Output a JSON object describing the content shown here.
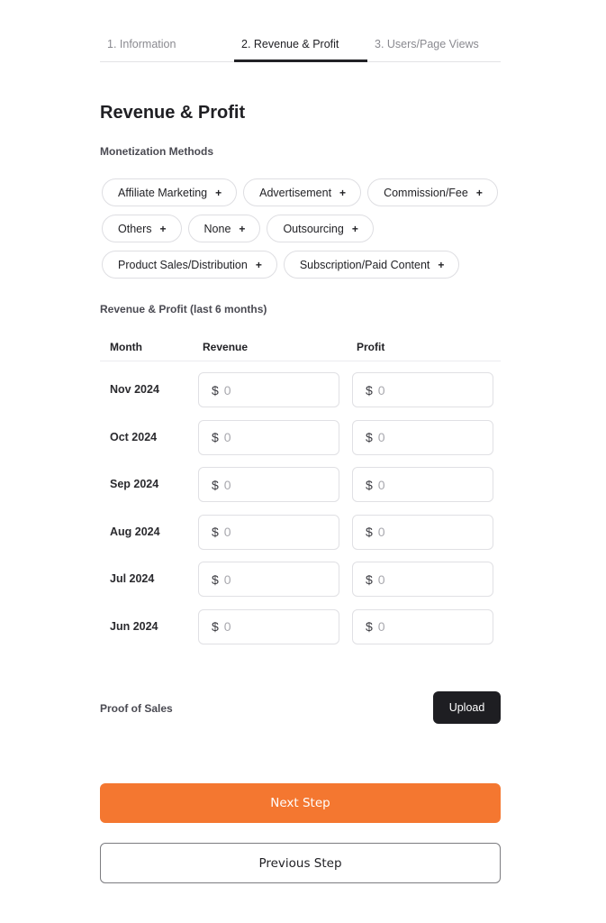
{
  "tabs": [
    {
      "label": "1. Information",
      "active": false
    },
    {
      "label": "2. Revenue & Profit",
      "active": true
    },
    {
      "label": "3. Users/Page Views",
      "active": false
    }
  ],
  "page_title": "Revenue & Profit",
  "monetization": {
    "label": "Monetization Methods",
    "add_icon": "plus-icon",
    "rows": [
      [
        "Affiliate Marketing",
        "Advertisement",
        "Commission/Fee"
      ],
      [
        "Others",
        "None",
        "Outsourcing"
      ],
      [
        "Product Sales/Distribution",
        "Subscription/Paid Content"
      ]
    ]
  },
  "revenue_table": {
    "label": "Revenue & Profit (last 6 months)",
    "headers": {
      "month": "Month",
      "revenue": "Revenue",
      "profit": "Profit"
    },
    "currency_symbol": "$",
    "placeholder": "0",
    "rows": [
      {
        "month": "Nov 2024",
        "revenue": "",
        "profit": ""
      },
      {
        "month": "Oct 2024",
        "revenue": "",
        "profit": ""
      },
      {
        "month": "Sep 2024",
        "revenue": "",
        "profit": ""
      },
      {
        "month": "Aug 2024",
        "revenue": "",
        "profit": ""
      },
      {
        "month": "Jul 2024",
        "revenue": "",
        "profit": ""
      },
      {
        "month": "Jun 2024",
        "revenue": "",
        "profit": ""
      }
    ]
  },
  "proof": {
    "label": "Proof of Sales",
    "upload_label": "Upload"
  },
  "buttons": {
    "next": "Next Step",
    "previous": "Previous Step"
  },
  "colors": {
    "accent": "#f47730",
    "dark": "#1e1e22"
  }
}
